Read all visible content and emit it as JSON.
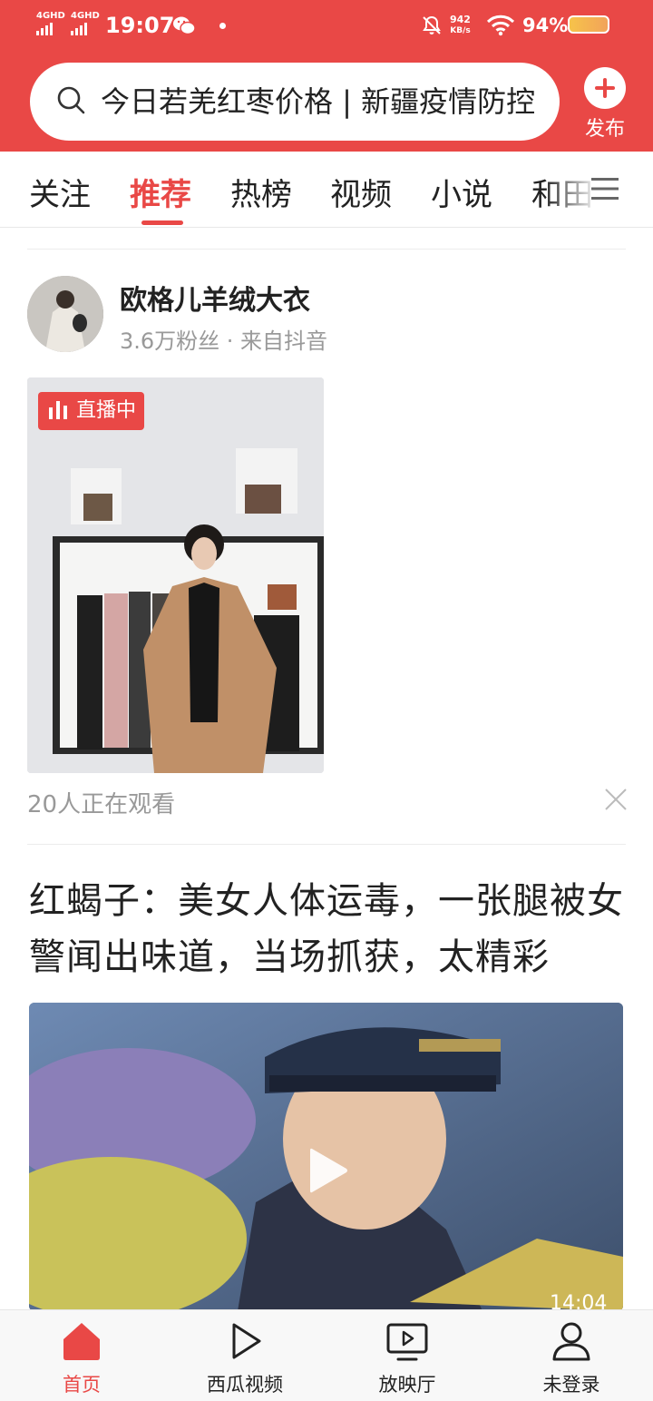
{
  "status_bar": {
    "signal1": "4GHD",
    "signal2": "4GHD",
    "time": "19:07",
    "speed_value": "942",
    "speed_unit": "KB/s",
    "battery": "94%"
  },
  "search": {
    "placeholder": "今日若羌红枣价格 | 新疆疫情防控"
  },
  "header": {
    "publish_label": "发布"
  },
  "tabs": [
    {
      "label": "关注"
    },
    {
      "label": "推荐"
    },
    {
      "label": "热榜"
    },
    {
      "label": "视频"
    },
    {
      "label": "小说"
    },
    {
      "label": "和田"
    }
  ],
  "live_card": {
    "author": "欧格儿羊绒大衣",
    "meta": "3.6万粉丝 · 来自抖音",
    "badge": "直播中",
    "viewers": "20人正在观看"
  },
  "article": {
    "title": "红蝎子：美女人体运毒，一张腿被女警闻出味道，当场抓获，太精彩",
    "duration": "14:04"
  },
  "bottom_nav": [
    {
      "label": "首页"
    },
    {
      "label": "西瓜视频"
    },
    {
      "label": "放映厅"
    },
    {
      "label": "未登录"
    }
  ],
  "colors": {
    "accent": "#e94846"
  }
}
